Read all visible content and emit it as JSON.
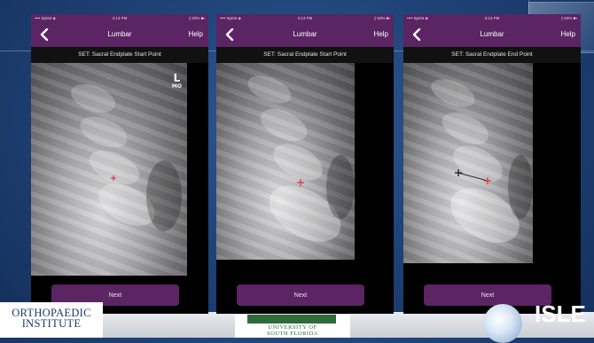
{
  "colors": {
    "accent": "#5b2463",
    "marker": "#e8323f",
    "start_marker": "#1a1a1a"
  },
  "screens": [
    {
      "status": {
        "carrier": "•••• Sprint ◈",
        "time": "3:13 PM",
        "battery": "▯ 53% ■▪"
      },
      "nav": {
        "back_icon": "chevron-left-icon",
        "title": "Lumbar",
        "help_label": "Help"
      },
      "instruction": "SET: Sacral Endplate Start Point",
      "xray_label": {
        "letter": "L",
        "sub": "MO"
      },
      "next_label": "Next"
    },
    {
      "status": {
        "carrier": "•••• Sprint ◈",
        "time": "3:13 PM",
        "battery": "▯ 53% ■▪"
      },
      "nav": {
        "back_icon": "chevron-left-icon",
        "title": "Lumbar",
        "help_label": "Help"
      },
      "instruction": "SET: Sacral Endplate Start Point",
      "next_label": "Next"
    },
    {
      "status": {
        "carrier": "•••• Sprint ◈",
        "time": "3:13 PM",
        "battery": "▯ 53% ■▪"
      },
      "nav": {
        "back_icon": "chevron-left-icon",
        "title": "Lumbar",
        "help_label": "Help"
      },
      "instruction": "SET: Sacral Endplate End Point",
      "next_label": "Next"
    }
  ],
  "logos": {
    "left": {
      "line1": "ORTHOPAEDIC",
      "line2": "INSTITUTE"
    },
    "middle": {
      "line1": "UNIVERSITY OF",
      "line2": "SOUTH FLORIDA"
    },
    "right": {
      "brand": "ISLE"
    }
  }
}
